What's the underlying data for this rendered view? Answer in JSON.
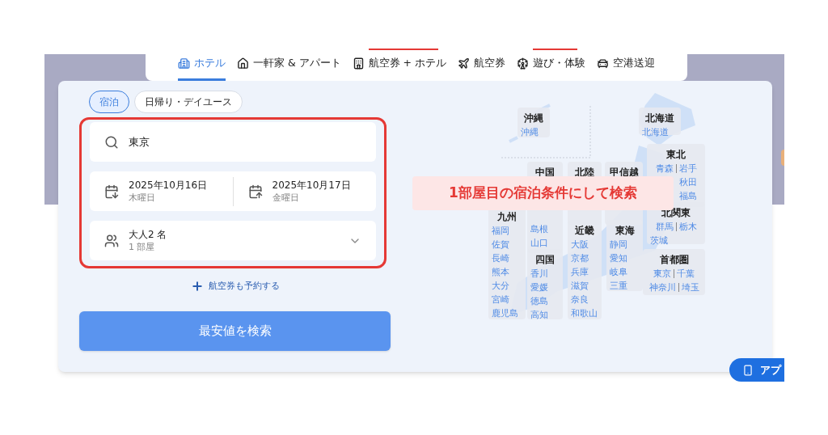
{
  "nav_tabs": [
    {
      "label": "ホテル",
      "selected": true,
      "badge": false
    },
    {
      "label": "一軒家 & アパート",
      "selected": false,
      "badge": false
    },
    {
      "label": "航空券 + ホテル",
      "selected": false,
      "badge": true
    },
    {
      "label": "航空券",
      "selected": false,
      "badge": false
    },
    {
      "label": "遊び・体験",
      "selected": false,
      "badge": true
    },
    {
      "label": "空港送迎",
      "selected": false,
      "badge": false
    }
  ],
  "stay_types": [
    {
      "label": "宿泊",
      "selected": true
    },
    {
      "label": "日帰り・デイユース",
      "selected": false
    }
  ],
  "destination": {
    "value": "東京"
  },
  "check_in": {
    "date": "2025年10月16日",
    "weekday": "木曜日"
  },
  "check_out": {
    "date": "2025年10月17日",
    "weekday": "金曜日"
  },
  "guests": {
    "adults": "大人2 名",
    "rooms": "1 部屋"
  },
  "add_flight": "航空券も予約する",
  "search_button": "最安値を検索",
  "map_regions": [
    {
      "name": "沖縄",
      "rows": [
        [
          "沖縄"
        ]
      ]
    },
    {
      "name": "北海道",
      "rows": [
        [
          "北海道"
        ]
      ]
    },
    {
      "name": "東北",
      "rows": [
        [
          "青森",
          "岩手"
        ],
        [
          "秋田"
        ],
        [
          "福島"
        ]
      ]
    },
    {
      "name": "中国",
      "rows": [
        [
          "島根"
        ],
        [
          "山口"
        ]
      ]
    },
    {
      "name": "北陸"
    },
    {
      "name": "甲信越"
    },
    {
      "name": "九州",
      "rows": [
        [
          "福岡"
        ],
        [
          "佐賀"
        ],
        [
          "長崎"
        ],
        [
          "熊本"
        ],
        [
          "大分"
        ],
        [
          "宮崎"
        ],
        [
          "鹿児島"
        ]
      ]
    },
    {
      "name": "北関東",
      "rows": [
        [
          "群馬",
          "栃木"
        ],
        [
          "茨城"
        ]
      ]
    },
    {
      "name": "近畿",
      "rows": [
        [
          "大阪"
        ],
        [
          "京都"
        ],
        [
          "兵庫"
        ],
        [
          "滋賀"
        ],
        [
          "奈良"
        ],
        [
          "和歌山"
        ]
      ]
    },
    {
      "name": "東海",
      "rows": [
        [
          "静岡"
        ],
        [
          "愛知"
        ],
        [
          "岐阜"
        ],
        [
          "三重"
        ]
      ]
    },
    {
      "name": "四国",
      "rows": [
        [
          "香川"
        ],
        [
          "愛媛"
        ],
        [
          "徳島"
        ],
        [
          "高知"
        ]
      ]
    },
    {
      "name": "首都圏",
      "rows": [
        [
          "東京",
          "千葉"
        ],
        [
          "神奈川",
          "埼玉"
        ]
      ]
    }
  ],
  "annotation": "1部屋目の宿泊条件にして検索",
  "app_button": "アプ"
}
